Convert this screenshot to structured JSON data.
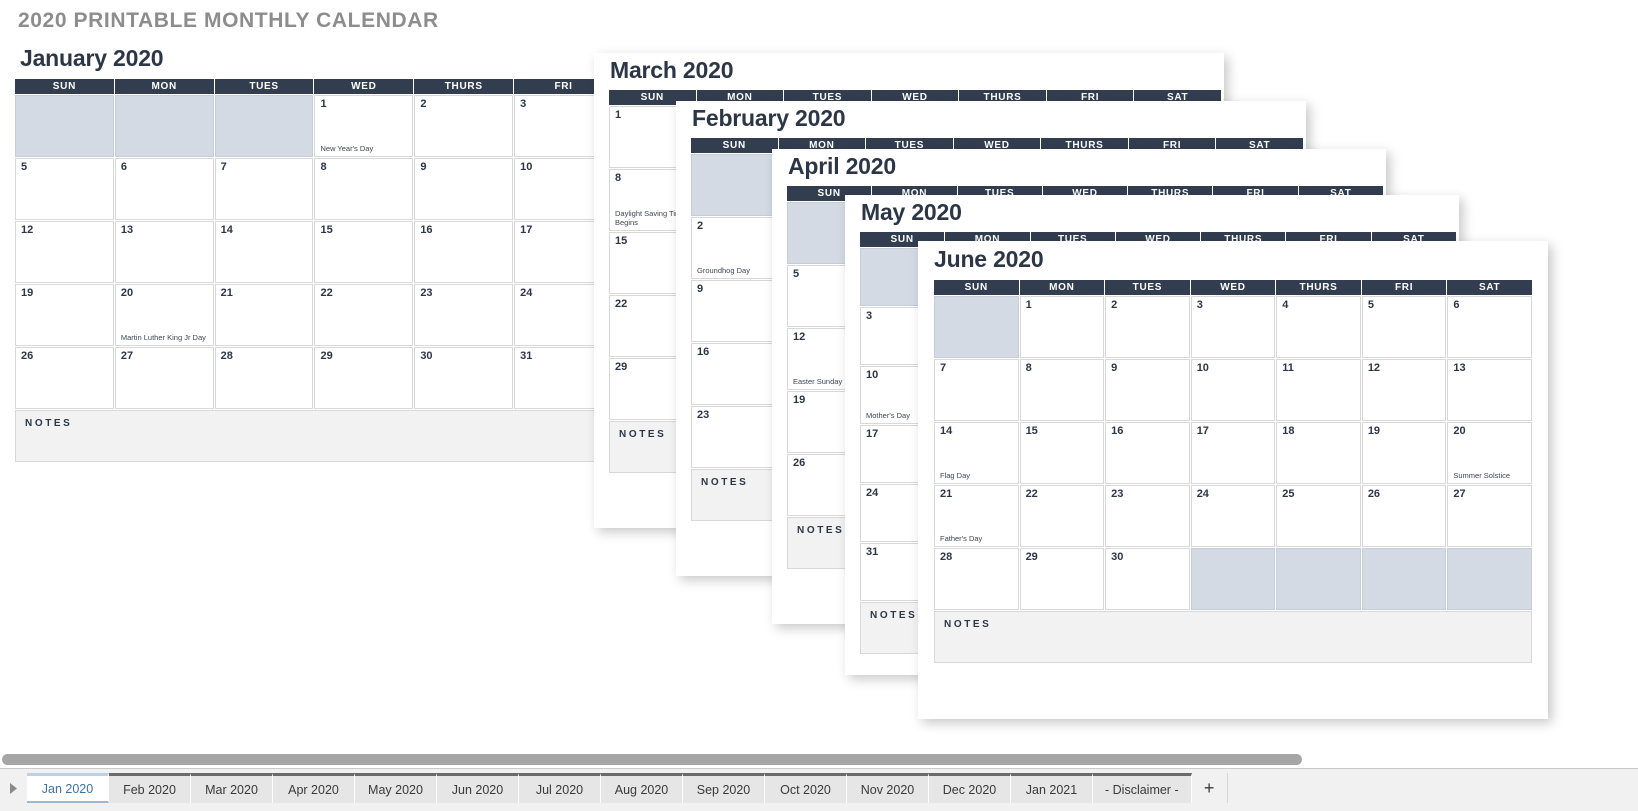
{
  "document": {
    "title": "2020 PRINTABLE MONTHLY CALENDAR",
    "notes_label": "NOTES",
    "weekday_headers": [
      "SUN",
      "MON",
      "TUES",
      "WED",
      "THURS",
      "FRI",
      "SAT"
    ],
    "colors": {
      "header_navy": "#323e50",
      "blank_cell": "#d4dae4",
      "notes_bg": "#f2f2f2",
      "title_gray": "#8d8d8d",
      "day_text": "#2c3647",
      "active_tab_text": "#3b73a8"
    }
  },
  "panels": {
    "january": {
      "title": "January 2020",
      "headers": [
        "SUN",
        "MON",
        "TUES",
        "WED",
        "THURS",
        "FRI"
      ],
      "weeks": [
        [
          {
            "day": "",
            "blank": true
          },
          {
            "day": "",
            "blank": true
          },
          {
            "day": "",
            "blank": true
          },
          {
            "day": "1",
            "holiday": "New Year's Day"
          },
          {
            "day": "2",
            "holiday": ""
          },
          {
            "day": "3",
            "holiday": ""
          }
        ],
        [
          {
            "day": "5",
            "holiday": ""
          },
          {
            "day": "6",
            "holiday": ""
          },
          {
            "day": "7",
            "holiday": ""
          },
          {
            "day": "8",
            "holiday": ""
          },
          {
            "day": "9",
            "holiday": ""
          },
          {
            "day": "10",
            "holiday": ""
          }
        ],
        [
          {
            "day": "12",
            "holiday": ""
          },
          {
            "day": "13",
            "holiday": ""
          },
          {
            "day": "14",
            "holiday": ""
          },
          {
            "day": "15",
            "holiday": ""
          },
          {
            "day": "16",
            "holiday": ""
          },
          {
            "day": "17",
            "holiday": ""
          }
        ],
        [
          {
            "day": "19",
            "holiday": ""
          },
          {
            "day": "20",
            "holiday": "Martin Luther King Jr Day"
          },
          {
            "day": "21",
            "holiday": ""
          },
          {
            "day": "22",
            "holiday": ""
          },
          {
            "day": "23",
            "holiday": ""
          },
          {
            "day": "24",
            "holiday": ""
          }
        ],
        [
          {
            "day": "26",
            "holiday": ""
          },
          {
            "day": "27",
            "holiday": ""
          },
          {
            "day": "28",
            "holiday": ""
          },
          {
            "day": "29",
            "holiday": ""
          },
          {
            "day": "30",
            "holiday": ""
          },
          {
            "day": "31",
            "holiday": ""
          }
        ]
      ]
    },
    "march": {
      "title": "March 2020",
      "headers": [
        "SUN",
        "MON",
        "TUES",
        "WED",
        "THURS",
        "FRI",
        "SAT"
      ],
      "sun_column": [
        {
          "day": "1",
          "holiday": ""
        },
        {
          "day": "8",
          "holiday": "Daylight Saving Time Begins"
        },
        {
          "day": "15",
          "holiday": ""
        },
        {
          "day": "22",
          "holiday": ""
        },
        {
          "day": "29",
          "holiday": ""
        }
      ]
    },
    "february": {
      "title": "February 2020",
      "headers": [
        "SUN",
        "MON",
        "TUES",
        "WED",
        "THURS",
        "FRI",
        "SAT"
      ],
      "sun_column": [
        {
          "day": "",
          "blank": true
        },
        {
          "day": "2",
          "holiday": "Groundhog Day"
        },
        {
          "day": "9",
          "holiday": ""
        },
        {
          "day": "16",
          "holiday": ""
        },
        {
          "day": "23",
          "holiday": ""
        }
      ]
    },
    "april": {
      "title": "April 2020",
      "headers": [
        "SUN",
        "MON",
        "TUES",
        "WED",
        "THURS",
        "FRI",
        "SAT"
      ],
      "sun_column": [
        {
          "day": "",
          "blank": true
        },
        {
          "day": "5",
          "holiday": ""
        },
        {
          "day": "12",
          "holiday": "Easter Sunday"
        },
        {
          "day": "19",
          "holiday": ""
        },
        {
          "day": "26",
          "holiday": ""
        }
      ]
    },
    "may": {
      "title": "May 2020",
      "headers": [
        "SUN",
        "MON",
        "TUES",
        "WED",
        "THURS",
        "FRI",
        "SAT"
      ],
      "sun_column": [
        {
          "day": "",
          "blank": true
        },
        {
          "day": "3",
          "holiday": ""
        },
        {
          "day": "10",
          "holiday": "Mother's Day"
        },
        {
          "day": "17",
          "holiday": ""
        },
        {
          "day": "24",
          "holiday": ""
        },
        {
          "day": "31",
          "holiday": ""
        }
      ]
    },
    "june": {
      "title": "June 2020",
      "headers": [
        "SUN",
        "MON",
        "TUES",
        "WED",
        "THURS",
        "FRI",
        "SAT"
      ],
      "weeks": [
        [
          {
            "day": "",
            "blank": true
          },
          {
            "day": "1",
            "holiday": ""
          },
          {
            "day": "2",
            "holiday": ""
          },
          {
            "day": "3",
            "holiday": ""
          },
          {
            "day": "4",
            "holiday": ""
          },
          {
            "day": "5",
            "holiday": ""
          },
          {
            "day": "6",
            "holiday": ""
          }
        ],
        [
          {
            "day": "7",
            "holiday": ""
          },
          {
            "day": "8",
            "holiday": ""
          },
          {
            "day": "9",
            "holiday": ""
          },
          {
            "day": "10",
            "holiday": ""
          },
          {
            "day": "11",
            "holiday": ""
          },
          {
            "day": "12",
            "holiday": ""
          },
          {
            "day": "13",
            "holiday": ""
          }
        ],
        [
          {
            "day": "14",
            "holiday": "Flag Day"
          },
          {
            "day": "15",
            "holiday": ""
          },
          {
            "day": "16",
            "holiday": ""
          },
          {
            "day": "17",
            "holiday": ""
          },
          {
            "day": "18",
            "holiday": ""
          },
          {
            "day": "19",
            "holiday": ""
          },
          {
            "day": "20",
            "holiday": "Summer Solstice"
          }
        ],
        [
          {
            "day": "21",
            "holiday": "Father's Day"
          },
          {
            "day": "22",
            "holiday": ""
          },
          {
            "day": "23",
            "holiday": ""
          },
          {
            "day": "24",
            "holiday": ""
          },
          {
            "day": "25",
            "holiday": ""
          },
          {
            "day": "26",
            "holiday": ""
          },
          {
            "day": "27",
            "holiday": ""
          }
        ],
        [
          {
            "day": "28",
            "holiday": ""
          },
          {
            "day": "29",
            "holiday": ""
          },
          {
            "day": "30",
            "holiday": ""
          },
          {
            "day": "",
            "blank": true
          },
          {
            "day": "",
            "blank": true
          },
          {
            "day": "",
            "blank": true
          },
          {
            "day": "",
            "blank": true
          }
        ]
      ]
    }
  },
  "tabbar": {
    "tabs": [
      {
        "label": "Jan 2020",
        "active": true
      },
      {
        "label": "Feb 2020",
        "active": false
      },
      {
        "label": "Mar 2020",
        "active": false
      },
      {
        "label": "Apr 2020",
        "active": false
      },
      {
        "label": "May 2020",
        "active": false
      },
      {
        "label": "Jun 2020",
        "active": false
      },
      {
        "label": "Jul 2020",
        "active": false
      },
      {
        "label": "Aug 2020",
        "active": false
      },
      {
        "label": "Sep 2020",
        "active": false
      },
      {
        "label": "Oct 2020",
        "active": false
      },
      {
        "label": "Nov 2020",
        "active": false
      },
      {
        "label": "Dec 2020",
        "active": false
      },
      {
        "label": "Jan 2021",
        "active": false
      },
      {
        "label": "- Disclaimer -",
        "active": false
      }
    ],
    "add_label": "+"
  }
}
